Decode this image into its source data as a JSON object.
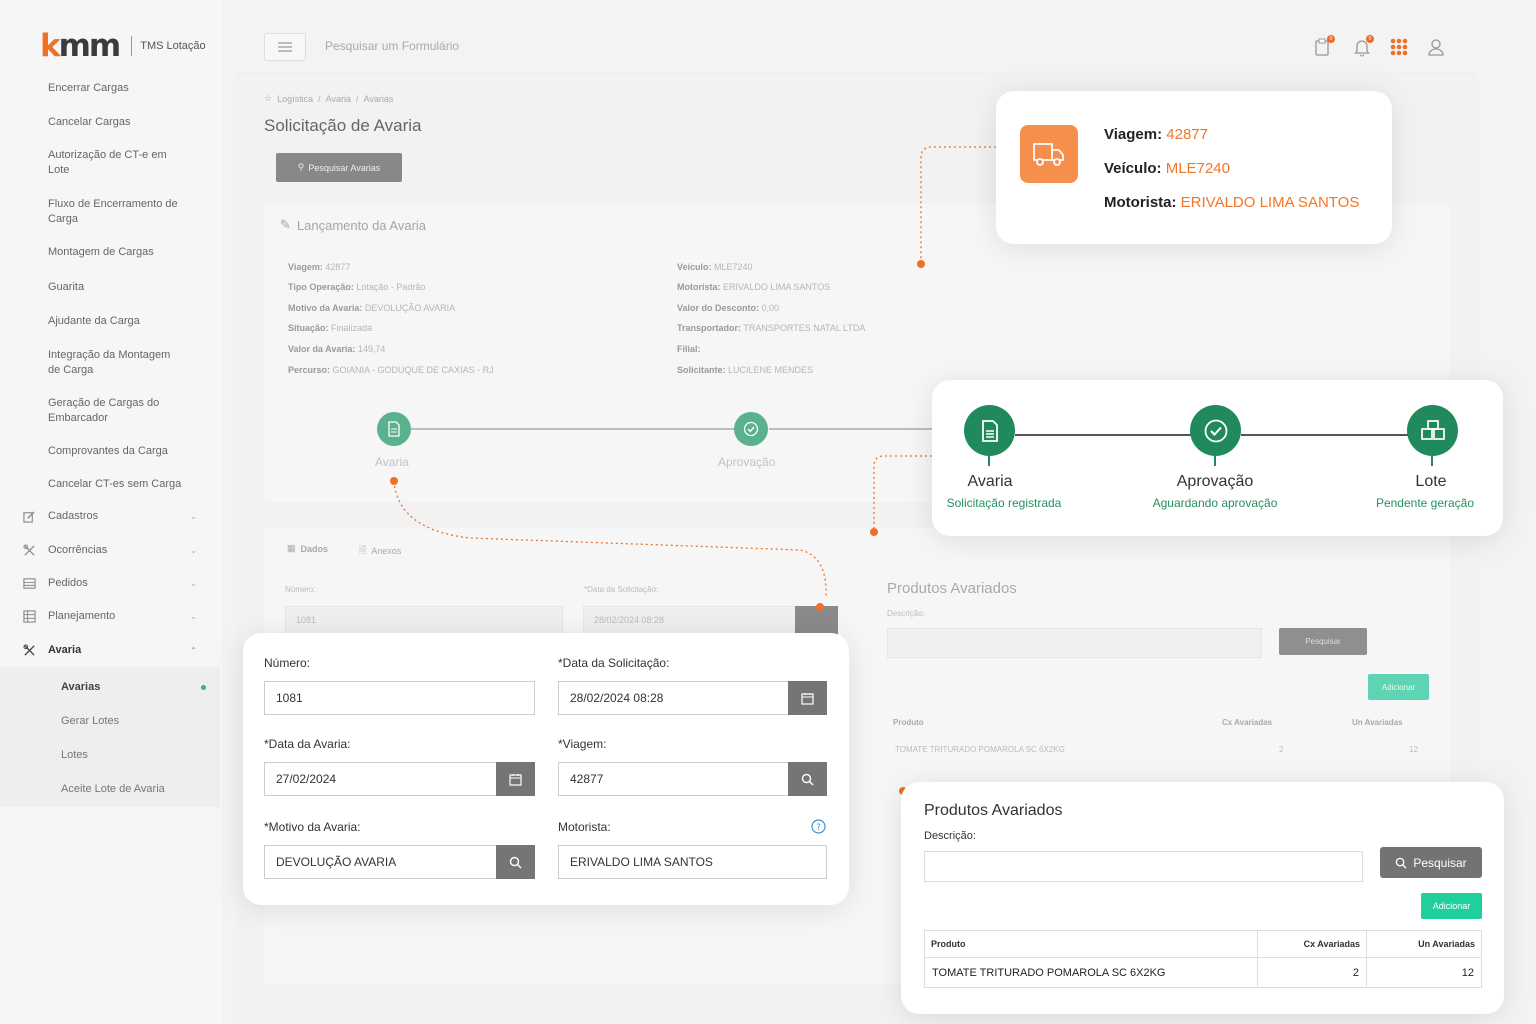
{
  "app": {
    "logo_text": "kmm",
    "logo_accent": "#ef7026",
    "product": "TMS Lotação"
  },
  "sidebar": {
    "items": [
      "Encerrar Cargas",
      "Cancelar Cargas",
      "Autorização de CT-e em Lote",
      "Fluxo de Encerramento de Carga",
      "Montagem de Cargas",
      "Guarita",
      "Ajudante da Carga",
      "Integração da Montagem de Carga",
      "Geração de Cargas do Embarcador",
      "Comprovantes da Carga",
      "Cancelar CT-es sem Carga"
    ],
    "sections": [
      "Cadastros",
      "Ocorrências",
      "Pedidos",
      "Planejamento",
      "Avaria"
    ],
    "avaria_sub": [
      "Avarias",
      "Gerar Lotes",
      "Lotes",
      "Aceite Lote de Avaria"
    ]
  },
  "header": {
    "search_placeholder": "Pesquisar um Formulário",
    "badge_1": "0",
    "badge_2": "0"
  },
  "breadcrumb": [
    "Logística",
    "Avaria",
    "Avarias"
  ],
  "page": {
    "title": "Solicitação de Avaria",
    "search_button": "Pesquisar Avarias"
  },
  "lancamento": {
    "title": "Lançamento da Avaria",
    "left": [
      {
        "k": "Viagem:",
        "v": "42877"
      },
      {
        "k": "Tipo Operação:",
        "v": "Lotação - Padrão"
      },
      {
        "k": "Motivo da Avaria:",
        "v": "DEVOLUÇÃO AVARIA"
      },
      {
        "k": "Situação:",
        "v": "Finalizada"
      },
      {
        "k": "Valor da Avaria:",
        "v": "149,74"
      },
      {
        "k": "Percurso:",
        "v": "GOIANIA - GODUQUE DE CAXIAS - RJ"
      }
    ],
    "right": [
      {
        "k": "Veículo:",
        "v": "MLE7240"
      },
      {
        "k": "Motorista:",
        "v": "ERIVALDO LIMA SANTOS"
      },
      {
        "k": "Valor do Desconto:",
        "v": "0,00"
      },
      {
        "k": "Transportador:",
        "v": "TRANSPORTES NATAL LTDA"
      },
      {
        "k": "Filial:",
        "v": ""
      },
      {
        "k": "Solicitante:",
        "v": "LUCILENE MENDES"
      }
    ],
    "timeline": [
      "Avaria",
      "Aprovação"
    ]
  },
  "tabs": [
    "Dados",
    "Anexos"
  ],
  "ghost_form": {
    "numero_lbl": "Número:",
    "numero": "1081",
    "data_lbl": "*Data da Solicitação:",
    "data": "28/02/2024 08:28"
  },
  "ghost_products": {
    "title": "Produtos Avariados",
    "desc": "Descrição:",
    "search": "Pesquisar",
    "add": "Adicionar",
    "cols": [
      "Produto",
      "Cx Avariadas",
      "Un Avariadas"
    ],
    "row": [
      "TOMATE TRITURADO POMAROLA SC 6X2KG",
      "2",
      "12"
    ]
  },
  "trip": {
    "viagem_lbl": "Viagem:",
    "viagem": "42877",
    "veiculo_lbl": "Veículo:",
    "veiculo": "MLE7240",
    "motorista_lbl": "Motorista:",
    "motorista": "ERIVALDO LIMA SANTOS",
    "accent": "#f27623"
  },
  "status": [
    {
      "title": "Avaria",
      "sub": "Solicitação registrada"
    },
    {
      "title": "Aprovação",
      "sub": "Aguardando aprovação"
    },
    {
      "title": "Lote",
      "sub": "Pendente geração"
    }
  ],
  "form": {
    "numero_lbl": "Número:",
    "numero": "1081",
    "data_sol_lbl": "*Data da Solicitação:",
    "data_sol": "28/02/2024 08:28",
    "data_av_lbl": "*Data da Avaria:",
    "data_av": "27/02/2024",
    "viagem_lbl": "*Viagem:",
    "viagem": "42877",
    "motivo_lbl": "*Motivo da Avaria:",
    "motivo": "DEVOLUÇÃO AVARIA",
    "motorista_lbl": "Motorista:",
    "motorista": "ERIVALDO LIMA SANTOS"
  },
  "products": {
    "title": "Produtos Avariados",
    "desc_lbl": "Descrição:",
    "search": "Pesquisar",
    "add": "Adicionar",
    "cols": [
      "Produto",
      "Cx Avariadas",
      "Un Avariadas"
    ],
    "rows": [
      {
        "produto": "TOMATE TRITURADO POMAROLA SC 6X2KG",
        "cx": "2",
        "un": "12"
      }
    ]
  },
  "colors": {
    "green": "#208a5c",
    "teal_button": "#1fcf9e",
    "orange": "#ef7026"
  }
}
